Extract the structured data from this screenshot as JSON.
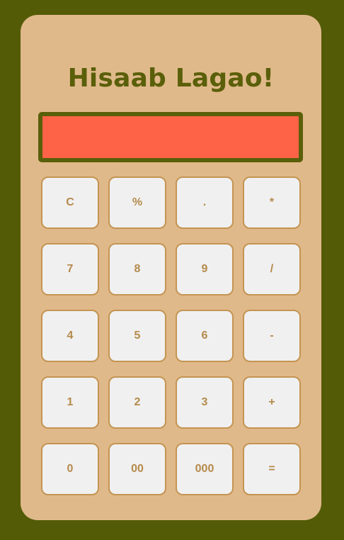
{
  "app": {
    "title": "Hisaab Lagao!"
  },
  "display": {
    "value": ""
  },
  "keypad": {
    "rows": [
      [
        "C",
        "%",
        ".",
        "*"
      ],
      [
        "7",
        "8",
        "9",
        "/"
      ],
      [
        "4",
        "5",
        "6",
        "-"
      ],
      [
        "1",
        "2",
        "3",
        "+"
      ],
      [
        "0",
        "00",
        "000",
        "="
      ]
    ]
  },
  "colors": {
    "page_background": "#535b07",
    "card_background": "#e0b98a",
    "title_color": "#5a5f0a",
    "display_background": "#ff6347",
    "display_border": "#5a5f0a",
    "key_background": "#f0f0f0",
    "key_border": "#c49452",
    "key_text": "#b58a4b"
  }
}
